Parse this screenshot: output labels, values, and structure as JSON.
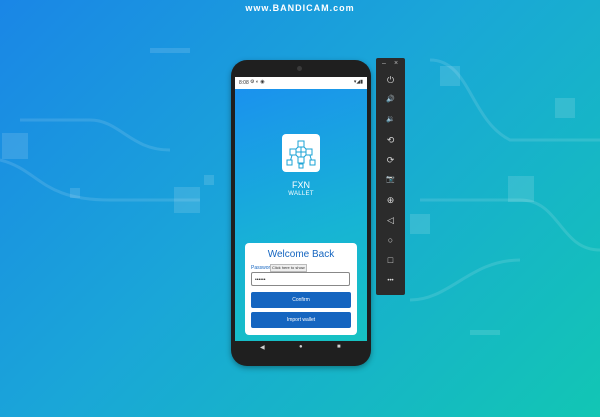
{
  "watermark": "www.BANDICAM.com",
  "phone": {
    "status_bar": {
      "time": "8:08",
      "left_icons": "⚙ ◐ ◉",
      "right_icons": "▾◢▮"
    },
    "app": {
      "title": "FXN",
      "subtitle": "WALLET"
    },
    "login_card": {
      "heading": "Welcome Back",
      "password_label": "Password",
      "show_tip": "Click here to show",
      "password_value": "••••••",
      "confirm_label": "Confirm",
      "import_label": "Import wallet"
    },
    "nav": {
      "back": "◀",
      "home": "●",
      "recents": "■"
    }
  },
  "emulator_toolbar": {
    "minimize": "–",
    "close": "×",
    "buttons": [
      {
        "name": "power",
        "icon": "power-icon",
        "glyph": "⏻"
      },
      {
        "name": "volume-up",
        "icon": "volume-up-icon",
        "glyph": "🔊"
      },
      {
        "name": "volume-down",
        "icon": "volume-down-icon",
        "glyph": "🔉"
      },
      {
        "name": "rotate-left",
        "icon": "rotate-left-icon",
        "glyph": "⟲"
      },
      {
        "name": "rotate-right",
        "icon": "rotate-right-icon",
        "glyph": "⟳"
      },
      {
        "name": "screenshot",
        "icon": "camera-icon",
        "glyph": "📷"
      },
      {
        "name": "zoom",
        "icon": "zoom-icon",
        "glyph": "⊕"
      },
      {
        "name": "back",
        "icon": "back-icon",
        "glyph": "◁"
      },
      {
        "name": "home",
        "icon": "home-icon",
        "glyph": "○"
      },
      {
        "name": "overview",
        "icon": "overview-icon",
        "glyph": "□"
      },
      {
        "name": "more",
        "icon": "more-icon",
        "glyph": "•••"
      }
    ]
  },
  "colors": {
    "brand": "#1565c0",
    "bg_start": "#1a86e6",
    "bg_end": "#12c6b4"
  }
}
